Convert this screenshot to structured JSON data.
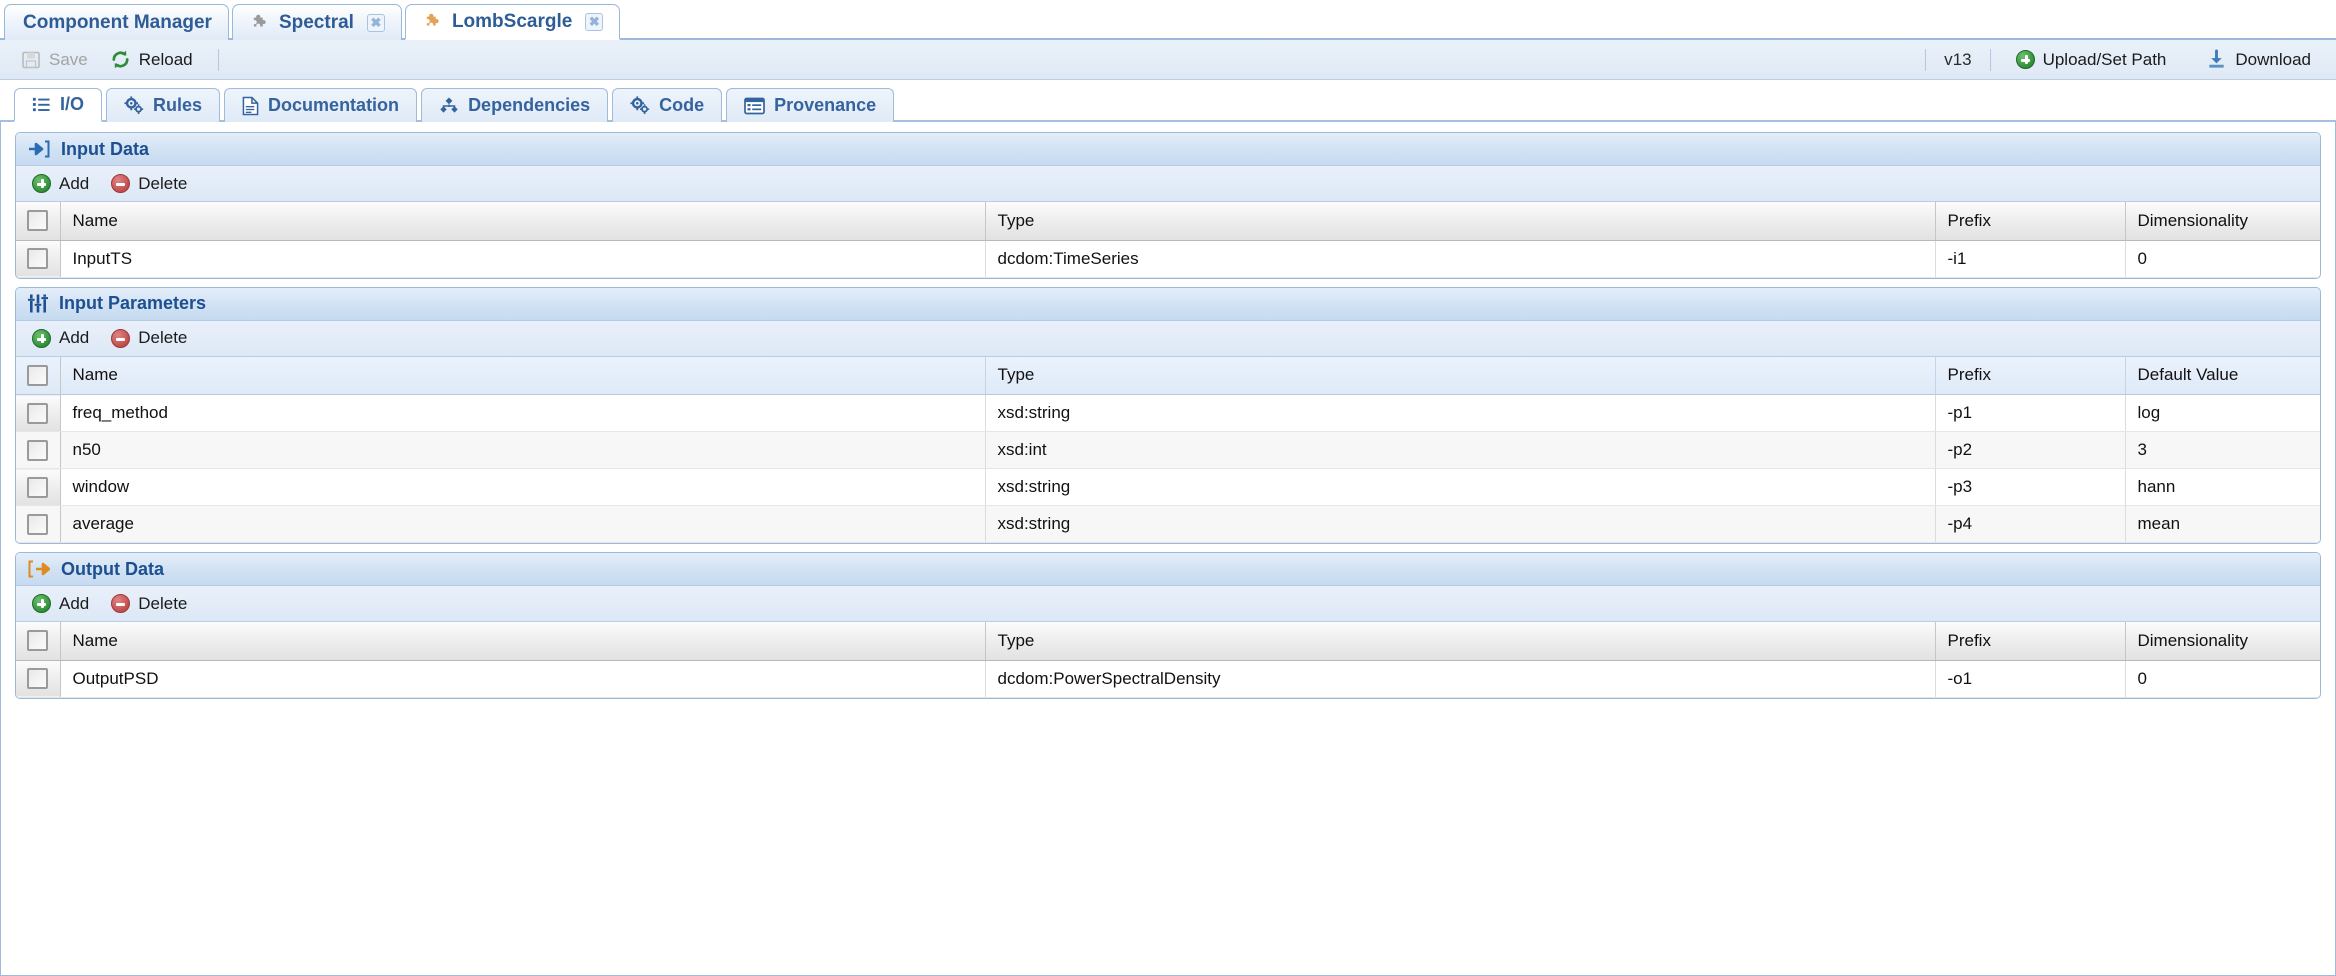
{
  "window_tabs": [
    {
      "label": "Component Manager",
      "icon": null,
      "closable": false,
      "active": false
    },
    {
      "label": "Spectral",
      "icon": "puzzle-piece-icon",
      "closable": true,
      "active": false
    },
    {
      "label": "LombScargle",
      "icon": "puzzle-piece-icon",
      "closable": true,
      "active": true
    }
  ],
  "toolbar": {
    "save_label": "Save",
    "save_icon": "floppy-disk-icon",
    "save_enabled": false,
    "reload_label": "Reload",
    "reload_icon": "refresh-icon",
    "version_label": "v13",
    "upload_label": "Upload/Set Path",
    "upload_icon": "plus-circle-icon",
    "download_label": "Download",
    "download_icon": "download-icon"
  },
  "inner_tabs": [
    {
      "label": "I/O",
      "icon": "list-icon",
      "active": true
    },
    {
      "label": "Rules",
      "icon": "gears-icon",
      "active": false
    },
    {
      "label": "Documentation",
      "icon": "document-icon",
      "active": false
    },
    {
      "label": "Dependencies",
      "icon": "hierarchy-icon",
      "active": false
    },
    {
      "label": "Code",
      "icon": "gears-icon",
      "active": false
    },
    {
      "label": "Provenance",
      "icon": "table-list-icon",
      "active": false
    }
  ],
  "sections": [
    {
      "id": "input-data",
      "title": "Input Data",
      "icon": "arrow-into-bracket-icon",
      "icon_color": "#2a6db5",
      "tinted_header": false,
      "toolbar": {
        "add_label": "Add",
        "delete_label": "Delete"
      },
      "columns": [
        "Name",
        "Type",
        "Prefix",
        "Dimensionality"
      ],
      "rows": [
        {
          "name": "InputTS",
          "type": "dcdom:TimeSeries",
          "prefix": "-i1",
          "last": "0"
        }
      ]
    },
    {
      "id": "input-parameters",
      "title": "Input Parameters",
      "icon": "sliders-icon",
      "icon_color": "#1d4f91",
      "tinted_header": true,
      "toolbar": {
        "add_label": "Add",
        "delete_label": "Delete"
      },
      "columns": [
        "Name",
        "Type",
        "Prefix",
        "Default Value"
      ],
      "rows": [
        {
          "name": "freq_method",
          "type": "xsd:string",
          "prefix": "-p1",
          "last": "log"
        },
        {
          "name": "n50",
          "type": "xsd:int",
          "prefix": "-p2",
          "last": "3"
        },
        {
          "name": "window",
          "type": "xsd:string",
          "prefix": "-p3",
          "last": "hann"
        },
        {
          "name": "average",
          "type": "xsd:string",
          "prefix": "-p4",
          "last": "mean"
        }
      ]
    },
    {
      "id": "output-data",
      "title": "Output Data",
      "icon": "arrow-out-of-bracket-icon",
      "icon_color": "#e08a23",
      "tinted_header": false,
      "toolbar": {
        "add_label": "Add",
        "delete_label": "Delete"
      },
      "columns": [
        "Name",
        "Type",
        "Prefix",
        "Dimensionality"
      ],
      "rows": [
        {
          "name": "OutputPSD",
          "type": "dcdom:PowerSpectralDensity",
          "prefix": "-o1",
          "last": "0"
        }
      ]
    }
  ],
  "colors": {
    "accent_blue": "#2e5c96",
    "panel_title": "#1d4f91",
    "tab_border": "#9ab7dc",
    "add_green": "#2e8b36",
    "delete_red": "#bf4a4a",
    "output_orange": "#e08a23"
  }
}
